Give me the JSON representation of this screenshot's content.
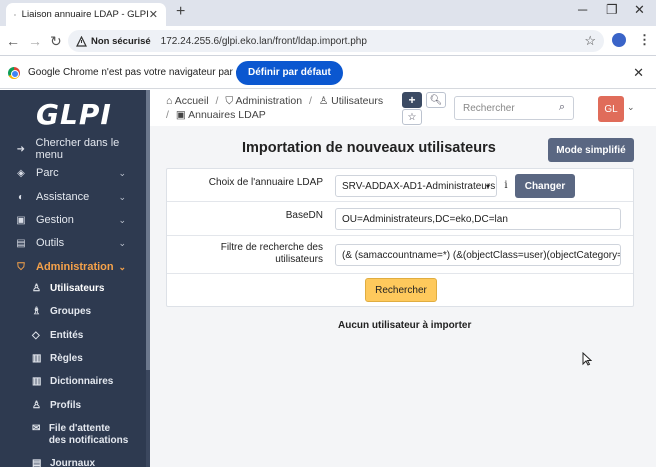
{
  "browser": {
    "tab_title": "Liaison annuaire LDAP - GLPI",
    "address_security": "Non sécurisé",
    "url": "172.24.255.6/glpi.eko.lan/front/ldap.import.php",
    "infobar_message": "Google Chrome n'est pas votre navigateur par défaut",
    "infobar_button": "Définir par défaut"
  },
  "sidebar": {
    "logo": "GLPI",
    "items": [
      {
        "label": "Chercher dans le menu",
        "icon": "arrow-right-icon"
      },
      {
        "label": "Parc",
        "icon": "box-icon"
      },
      {
        "label": "Assistance",
        "icon": "headset-icon"
      },
      {
        "label": "Gestion",
        "icon": "wallet-icon"
      },
      {
        "label": "Outils",
        "icon": "briefcase-icon"
      },
      {
        "label": "Administration",
        "icon": "shield-icon"
      }
    ],
    "subitems": [
      {
        "label": "Utilisateurs",
        "icon": "user-icon"
      },
      {
        "label": "Groupes",
        "icon": "users-icon"
      },
      {
        "label": "Entités",
        "icon": "stack-icon"
      },
      {
        "label": "Règles",
        "icon": "book-icon"
      },
      {
        "label": "Dictionnaires",
        "icon": "book-icon"
      },
      {
        "label": "Profils",
        "icon": "user-check-icon"
      },
      {
        "label": "File d'attente des notifications",
        "icon": "mail-icon"
      },
      {
        "label": "Journaux",
        "icon": "log-icon"
      }
    ]
  },
  "header": {
    "breadcrumb": [
      "Accueil",
      "Administration",
      "Utilisateurs",
      "Annuaires LDAP"
    ],
    "search_placeholder": "Rechercher",
    "avatar": "GL"
  },
  "main": {
    "title": "Importation de nouveaux utilisateurs",
    "mode_button": "Mode simplifié",
    "directory_label": "Choix de l'annuaire LDAP",
    "directory_value": "SRV-ADDAX-AD1-Administrateurs",
    "info_icon": "i",
    "change_button": "Changer",
    "basedn_label": "BaseDN",
    "basedn_value": "OU=Administrateurs,DC=eko,DC=lan",
    "filter_label": "Filtre de recherche des utilisateurs",
    "filter_value": "(& (samaccountname=*) (&(objectClass=user)(objectCategory=",
    "search_button": "Rechercher",
    "no_users": "Aucun utilisateur à importer"
  },
  "colors": {
    "sidebar_bg": "#2e3a50",
    "active_accent": "#f6a24a",
    "button_bg": "#5a6782",
    "search_button_bg": "#fec95c",
    "chrome_blue": "#0b57d0"
  }
}
